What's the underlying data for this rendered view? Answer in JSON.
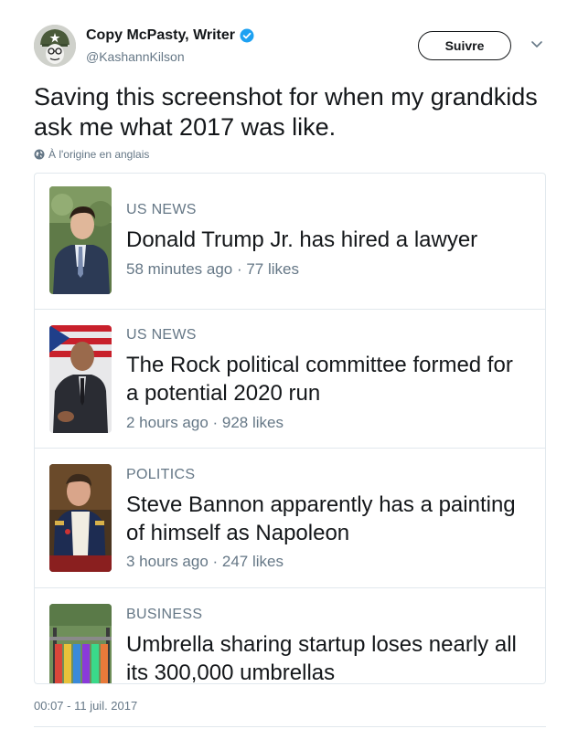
{
  "tweet": {
    "author": {
      "display_name": "Copy McPasty, Writer",
      "handle": "@KashannKilson",
      "verified": true,
      "avatar_icon": "soldier-avatar-icon"
    },
    "follow_label": "Suivre",
    "text": "Saving this screenshot for when my grandkids ask me what 2017 was like.",
    "translation_note": "À l'origine en anglais",
    "timestamp": "00:07 - 11 juil. 2017"
  },
  "colors": {
    "text": "#14171a",
    "secondary": "#657786",
    "border": "#e1e8ed",
    "verified": "#1da1f2"
  },
  "news_items": [
    {
      "category": "US NEWS",
      "headline": "Donald Trump Jr. has hired a lawyer",
      "meta": "58 minutes ago · 77 likes",
      "thumbnail": "man-in-suit-photo"
    },
    {
      "category": "US NEWS",
      "headline": "The Rock political committee formed for a potential 2020 run",
      "meta": "2 hours ago · 928 likes",
      "thumbnail": "man-with-flag-photo"
    },
    {
      "category": "POLITICS",
      "headline": "Steve Bannon apparently has a painting of himself as Napoleon",
      "meta": "3 hours ago · 247 likes",
      "thumbnail": "napoleon-painting-photo"
    },
    {
      "category": "BUSINESS",
      "headline": "Umbrella sharing startup loses nearly all its 300,000 umbrellas",
      "meta": "",
      "thumbnail": "umbrellas-photo"
    }
  ]
}
